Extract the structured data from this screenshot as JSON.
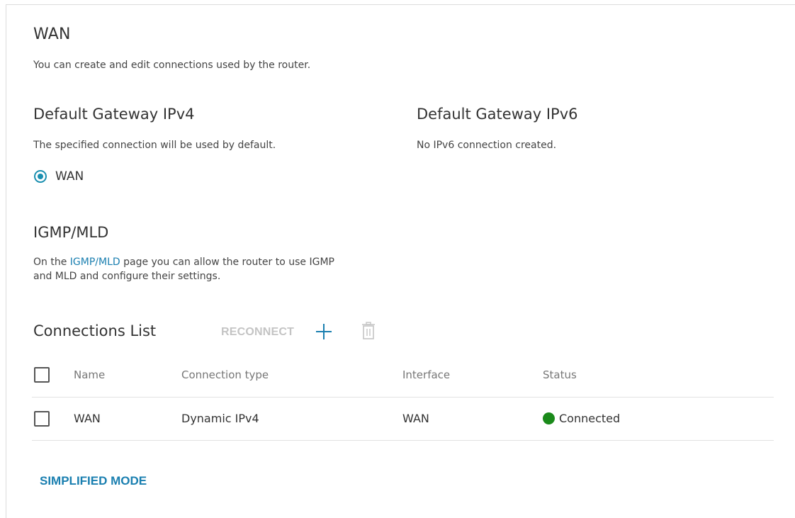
{
  "page": {
    "title": "WAN",
    "description": "You can create and edit connections used by the router."
  },
  "gateway_ipv4": {
    "title": "Default Gateway IPv4",
    "description": "The specified connection will be used by default.",
    "options": [
      {
        "label": "WAN",
        "selected": true
      }
    ]
  },
  "gateway_ipv6": {
    "title": "Default Gateway IPv6",
    "description": "No IPv6 connection created."
  },
  "igmp": {
    "title": "IGMP/MLD",
    "text_before": "On the ",
    "link_label": "IGMP/MLD",
    "text_after": " page you can allow the router to use IGMP",
    "text_line2": "and MLD and configure their settings."
  },
  "connections": {
    "title": "Connections List",
    "reconnect_label": "RECONNECT",
    "add_icon": "plus-icon",
    "delete_icon": "trash-icon",
    "columns": [
      "Name",
      "Connection type",
      "Interface",
      "Status"
    ],
    "rows": [
      {
        "name": "WAN",
        "type": "Dynamic IPv4",
        "interface": "WAN",
        "status": "Connected",
        "status_color": "#1a8a1a"
      }
    ]
  },
  "footer": {
    "simplified_mode_label": "SIMPLIFIED MODE"
  },
  "colors": {
    "accent": "#1a7fb0",
    "disabled": "#c4c4c4",
    "connected": "#1a8a1a"
  }
}
